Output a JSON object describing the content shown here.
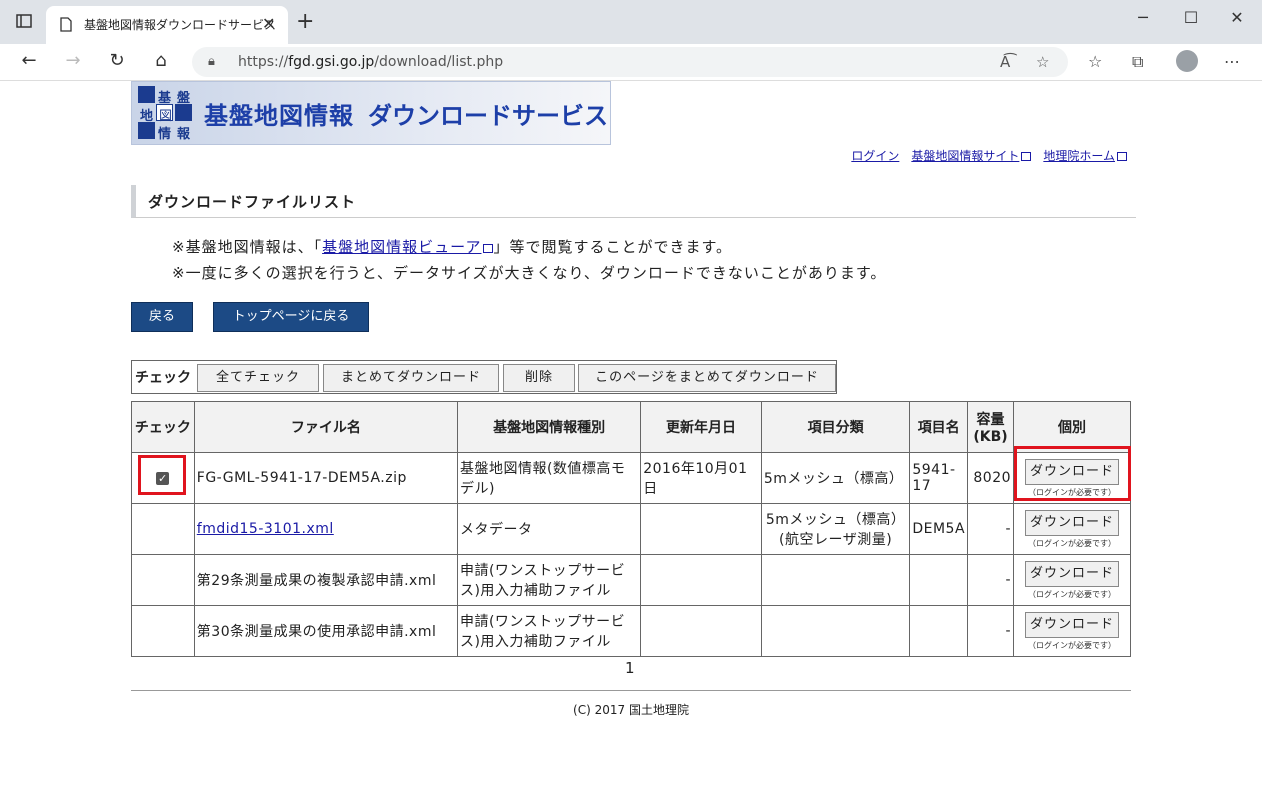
{
  "browser": {
    "tab_title": "基盤地図情報ダウンロードサービス",
    "url_prefix": "https://",
    "url_host": "fgd.gsi.go.jp",
    "url_path": "/download/list.php"
  },
  "header": {
    "logo_chars": [
      "基",
      "盤",
      "地",
      "図",
      "情",
      "報"
    ],
    "banner_title": "基盤地図情報",
    "banner_subtitle": "ダウンロードサービス",
    "links": [
      {
        "label": "ログイン"
      },
      {
        "label": "基盤地図情報サイト"
      },
      {
        "label": "地理院ホーム"
      }
    ]
  },
  "section_title": "ダウンロードファイルリスト",
  "notes": {
    "line1_prefix": "※基盤地図情報は、「",
    "line1_link": "基盤地図情報ビューア",
    "line1_suffix": "」等で閲覧することができます。",
    "line2": "※一度に多くの選択を行うと、データサイズが大きくなり、ダウンロードできないことがあります。"
  },
  "buttons": {
    "back": "戻る",
    "top_page": "トップページに戻る"
  },
  "actionbar": {
    "label": "チェック",
    "check_all": "全てチェック",
    "bulk_download": "まとめてダウンロード",
    "delete": "削除",
    "page_download": "このページをまとめてダウンロード"
  },
  "table": {
    "headers": [
      "チェック",
      "ファイル名",
      "基盤地図情報種別",
      "更新年月日",
      "項目分類",
      "項目名",
      "容量(KB)",
      "個別"
    ],
    "download_label": "ダウンロード",
    "download_note": "（ログインが必要です）",
    "rows": [
      {
        "checked": true,
        "filename": "FG-GML-5941-17-DEM5A.zip",
        "is_link": false,
        "type": "基盤地図情報(数値標高モデル)",
        "date": "2016年10月01日",
        "category": "5mメッシュ（標高）",
        "item": "5941-17",
        "size": "8020"
      },
      {
        "checked": false,
        "filename": "fmdid15-3101.xml",
        "is_link": true,
        "type": "メタデータ",
        "date": "",
        "category": "5mメッシュ（標高）(航空レーザ測量)",
        "item": "DEM5A",
        "size": "-"
      },
      {
        "checked": false,
        "filename": "第29条測量成果の複製承認申請.xml",
        "is_link": false,
        "type": "申請(ワンストップサービス)用入力補助ファイル",
        "date": "",
        "category": "",
        "item": "",
        "size": "-"
      },
      {
        "checked": false,
        "filename": "第30条測量成果の使用承認申請.xml",
        "is_link": false,
        "type": "申請(ワンストップサービス)用入力補助ファイル",
        "date": "",
        "category": "",
        "item": "",
        "size": "-"
      }
    ]
  },
  "pager": "1",
  "footer": "(C) 2017 国土地理院"
}
